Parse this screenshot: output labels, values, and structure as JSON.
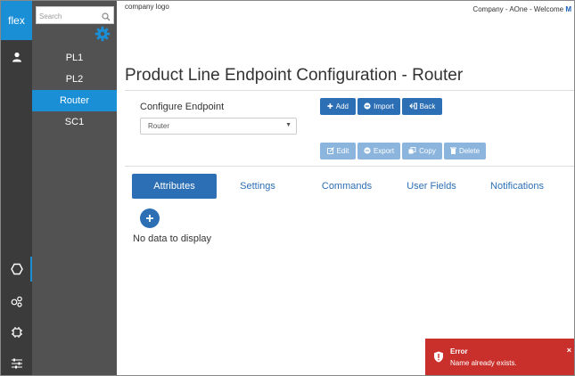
{
  "rail": {
    "brand": "flex",
    "items": [
      {
        "name": "user-icon"
      },
      {
        "name": "hexagon-icon"
      },
      {
        "name": "nodes-icon"
      },
      {
        "name": "chip-icon"
      },
      {
        "name": "sliders-icon"
      }
    ]
  },
  "tree": {
    "search_placeholder": "Search",
    "items": [
      {
        "label": "PL1"
      },
      {
        "label": "PL2"
      },
      {
        "label": "Router"
      },
      {
        "label": "SC1"
      }
    ],
    "selected": "Router"
  },
  "header": {
    "logo": "company logo",
    "welcome_prefix": "Company - AOne - Welcome",
    "welcome_user": "M"
  },
  "page": {
    "title": "Product Line Endpoint Configuration - Router",
    "configure_label": "Configure Endpoint",
    "select_value": "Router"
  },
  "toolbar": {
    "add": "Add",
    "import": "Import",
    "back": "Back",
    "edit": "Edit",
    "export": "Export",
    "copy": "Copy",
    "delete": "Delete"
  },
  "tabs": [
    {
      "label": "Attributes"
    },
    {
      "label": "Settings"
    },
    {
      "label": "Commands"
    },
    {
      "label": "User Fields"
    },
    {
      "label": "Notifications"
    }
  ],
  "content": {
    "empty_text": "No data to display"
  },
  "toast": {
    "title": "Error",
    "message": "Name already exists.",
    "close": "×"
  },
  "colors": {
    "brand_blue": "#1a8fd6",
    "primary_button": "#2d6fb5",
    "disabled_button": "#8cb5dd",
    "error": "#c9302c",
    "rail": "#3b3b3b",
    "tree": "#525252"
  }
}
